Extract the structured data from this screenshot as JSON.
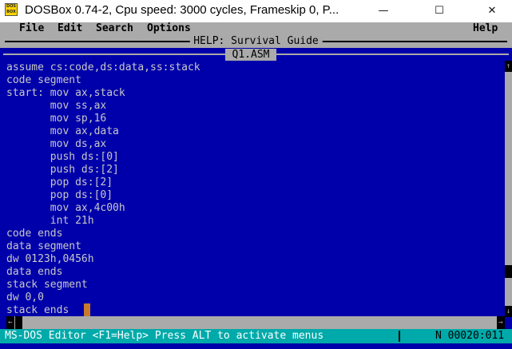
{
  "window": {
    "title": "DOSBox 0.74-2, Cpu speed:     3000 cycles, Frameskip  0, P...",
    "icon": "dosbox-icon",
    "icon_text": "DOS BOX",
    "minimize_glyph": "—",
    "maximize_glyph": "☐",
    "close_glyph": "✕"
  },
  "menubar": {
    "file": "File",
    "edit": "Edit",
    "search": "Search",
    "options": "Options",
    "help": "Help"
  },
  "help_window": {
    "title": "HELP: Survival Guide"
  },
  "document": {
    "title": "Q1.ASM",
    "lines": [
      "assume cs:code,ds:data,ss:stack",
      "code segment",
      "start: mov ax,stack",
      "       mov ss,ax",
      "       mov sp,16",
      "       mov ax,data",
      "       mov ds,ax",
      "       push ds:[0]",
      "       push ds:[2]",
      "       pop ds:[2]",
      "       pop ds:[0]",
      "       mov ax,4c00h",
      "       int 21h",
      "code ends",
      "data segment",
      "dw 0123h,0456h",
      "data ends",
      "stack segment",
      "dw 0,0",
      "stack ends"
    ]
  },
  "scrollbars": {
    "up_glyph": "↑",
    "down_glyph": "↓",
    "left_glyph": "←",
    "right_glyph": "→"
  },
  "statusbar": {
    "left": "MS-DOS Editor  <F1=Help> Press ALT to activate menus",
    "right": "N 00020:011"
  },
  "colors": {
    "dos_blue": "#0000aa",
    "dos_gray": "#aaaaaa",
    "status_cyan": "#00aaaa",
    "cursor": "#c87a2b"
  }
}
